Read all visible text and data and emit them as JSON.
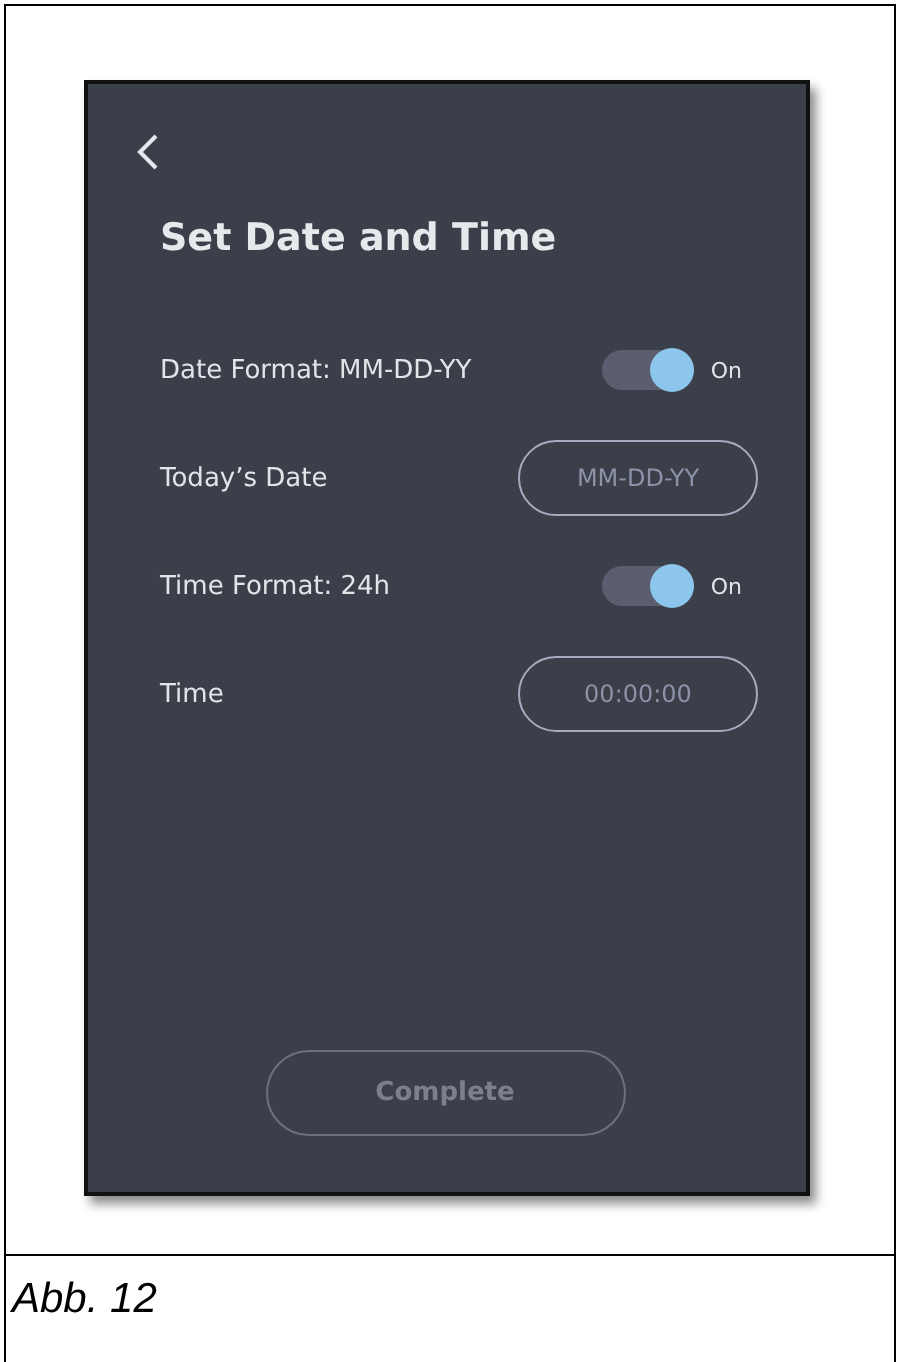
{
  "screen": {
    "title": "Set Date and Time",
    "settings": [
      {
        "kind": "toggle",
        "label": "Date Format: MM-DD-YY",
        "on": true,
        "state_label": "On"
      },
      {
        "kind": "field",
        "label": "Today’s Date",
        "placeholder": "MM-DD-YY"
      },
      {
        "kind": "toggle",
        "label": "Time Format: 24h",
        "on": true,
        "state_label": "On"
      },
      {
        "kind": "field",
        "label": "Time",
        "placeholder": "00:00:00"
      }
    ],
    "button": {
      "label": "Complete",
      "disabled": true
    }
  },
  "caption": "Abb. 12"
}
